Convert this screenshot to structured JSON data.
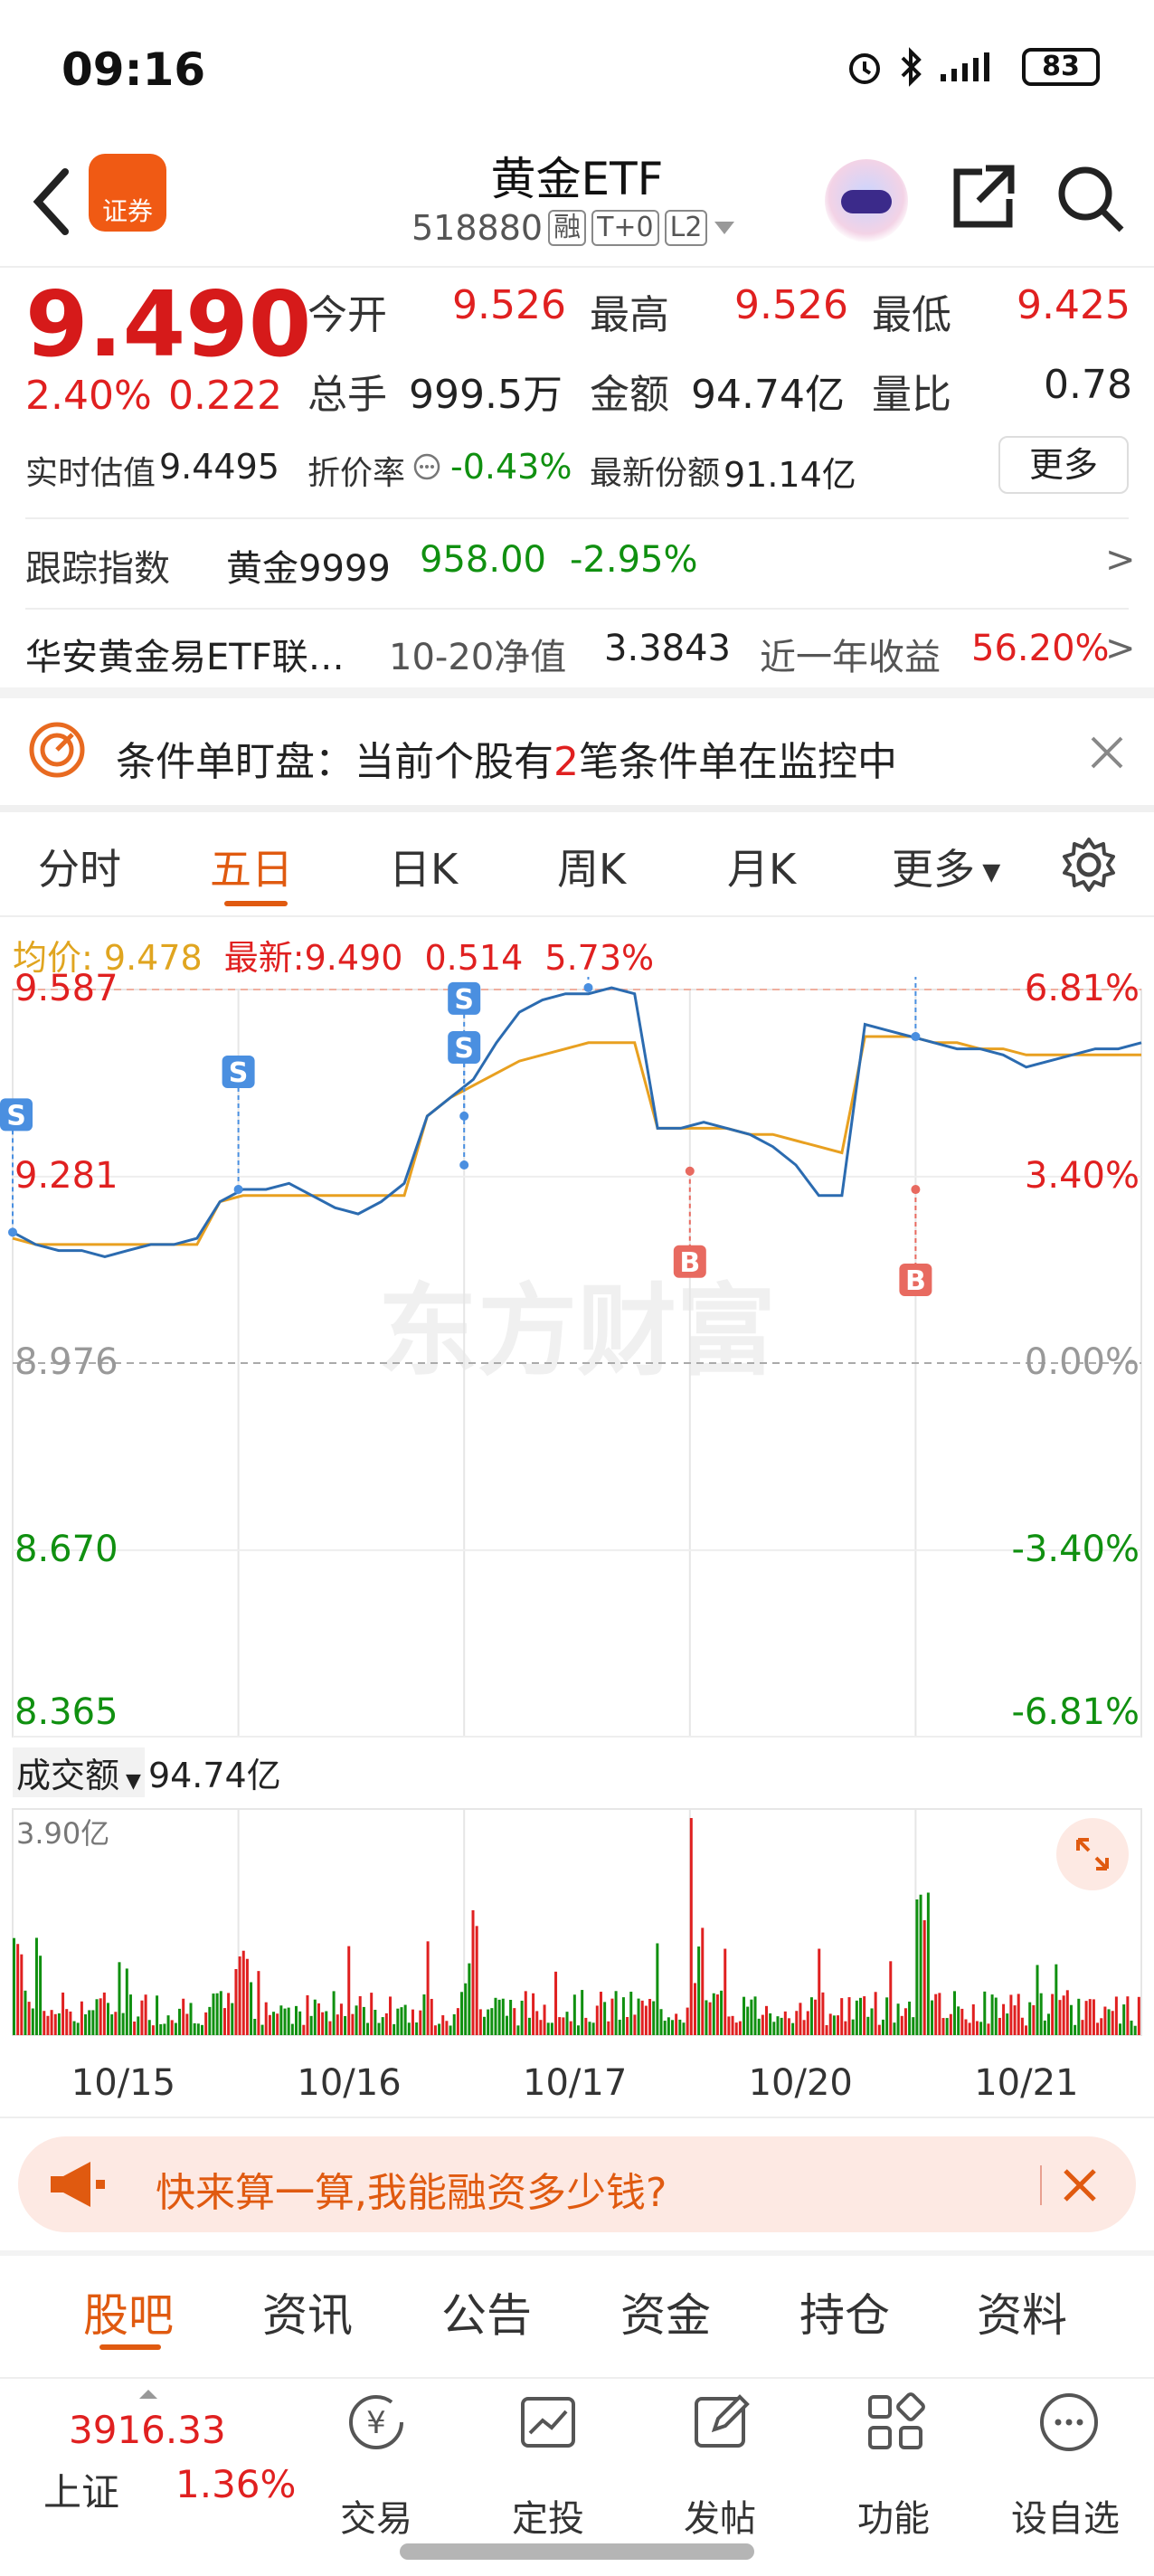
{
  "status": {
    "time": "09:16",
    "battery": "83"
  },
  "nav": {
    "title": "黄金ETF",
    "code": "518880",
    "tag1": "融",
    "tag2": "T+0",
    "tag3": "L2",
    "logo_text": "证券"
  },
  "quote": {
    "price": "9.490",
    "change_pct": "2.40%",
    "change": "0.222",
    "open_label": "今开",
    "open": "9.526",
    "high_label": "最高",
    "high": "9.526",
    "low_label": "最低",
    "low": "9.425",
    "vol_label": "总手",
    "vol": "999.5万",
    "amount_label": "金额",
    "amount": "94.74亿",
    "ratio_label": "量比",
    "ratio": "0.78",
    "iopv_label": "实时估值",
    "iopv": "9.4495",
    "discount_label": "折价率",
    "discount": "-0.43%",
    "shares_label": "最新份额",
    "shares": "91.14亿",
    "more": "更多"
  },
  "track": {
    "label": "跟踪指数",
    "index": "黄金9999",
    "value": "958.00",
    "pct": "-2.95%",
    "arrow": ">"
  },
  "fund": {
    "name": "华安黄金易ETF联…",
    "nav_label": "10-20净值",
    "nav": "3.3843",
    "yield_label": "近一年收益",
    "yield": "56.20%",
    "arrow": ">"
  },
  "alert": {
    "pre": "条件单盯盘：当前个股有",
    "num": "2",
    "post": "笔条件单在监控中"
  },
  "tabs": [
    "分时",
    "五日",
    "日K",
    "周K",
    "月K",
    "更多"
  ],
  "active_tab": "五日",
  "legend": {
    "avg_label": "均价:",
    "avg": "9.478",
    "latest_label": "最新:",
    "latest": "9.490",
    "chg": "0.514",
    "pct": "5.73%"
  },
  "chart_data": {
    "type": "line",
    "ylim": [
      8.365,
      9.587
    ],
    "y_ticks_left": [
      "9.587",
      "9.281",
      "8.976",
      "8.670",
      "8.365"
    ],
    "y_ticks_right": [
      "6.81%",
      "3.40%",
      "0.00%",
      "-3.40%",
      "-6.81%"
    ],
    "x_labels": [
      "10/15",
      "10/16",
      "10/17",
      "10/20",
      "10/21"
    ],
    "watermark": "东方财富",
    "series": [
      {
        "values": [
          9.19,
          9.17,
          9.16,
          9.16,
          9.15,
          9.16,
          9.17,
          9.17,
          9.18,
          9.24,
          9.26,
          9.26,
          9.27,
          9.25,
          9.23,
          9.22,
          9.24,
          9.27,
          9.38,
          9.41,
          9.44,
          9.5,
          9.55,
          9.57,
          9.58,
          9.58,
          9.59,
          9.58,
          9.36,
          9.36,
          9.37,
          9.36,
          9.35,
          9.33,
          9.3,
          9.25,
          9.25,
          9.53,
          9.52,
          9.51,
          9.5,
          9.49,
          9.49,
          9.48,
          9.46,
          9.47,
          9.48,
          9.49,
          9.49,
          9.5
        ]
      },
      {
        "values": [
          9.18,
          9.17,
          9.17,
          9.17,
          9.17,
          9.17,
          9.17,
          9.17,
          9.17,
          9.24,
          9.25,
          9.25,
          9.25,
          9.25,
          9.25,
          9.25,
          9.25,
          9.25,
          9.38,
          9.41,
          9.43,
          9.45,
          9.47,
          9.48,
          9.49,
          9.5,
          9.5,
          9.5,
          9.36,
          9.36,
          9.36,
          9.36,
          9.35,
          9.35,
          9.34,
          9.33,
          9.32,
          9.51,
          9.51,
          9.51,
          9.5,
          9.5,
          9.49,
          9.49,
          9.48,
          9.48,
          9.48,
          9.48,
          9.48,
          9.48
        ]
      }
    ],
    "markers": [
      {
        "type": "S",
        "x": 0.0,
        "y": 9.19
      },
      {
        "type": "S",
        "x": 0.2,
        "y": 9.26
      },
      {
        "type": "S",
        "x": 0.4,
        "y": 9.38
      },
      {
        "type": "S",
        "x": 0.4,
        "y": 9.3
      },
      {
        "type": "S",
        "x": 0.51,
        "y": 9.59
      },
      {
        "type": "B",
        "x": 0.6,
        "y": 9.29
      },
      {
        "type": "B",
        "x": 0.8,
        "y": 9.26
      },
      {
        "type": "S",
        "x": 0.8,
        "y": 9.51
      }
    ],
    "volume": {
      "label": "成交额",
      "value": "94.74亿",
      "max_label": "3.90亿"
    }
  },
  "promo": {
    "text": "快来算一算,我能融资多少钱?"
  },
  "bottom_tabs": [
    "股吧",
    "资讯",
    "公告",
    "资金",
    "持仓",
    "资料"
  ],
  "dock": {
    "index_value": "3916.33",
    "index_name": "上证",
    "index_pct": "1.36%",
    "items": [
      "交易",
      "定投",
      "发帖",
      "功能",
      "设自选"
    ]
  },
  "colors": {
    "up": "#e02020",
    "down": "#109010",
    "avg": "#e8a020",
    "line": "#2b6bb0",
    "accent": "#e05a10"
  }
}
